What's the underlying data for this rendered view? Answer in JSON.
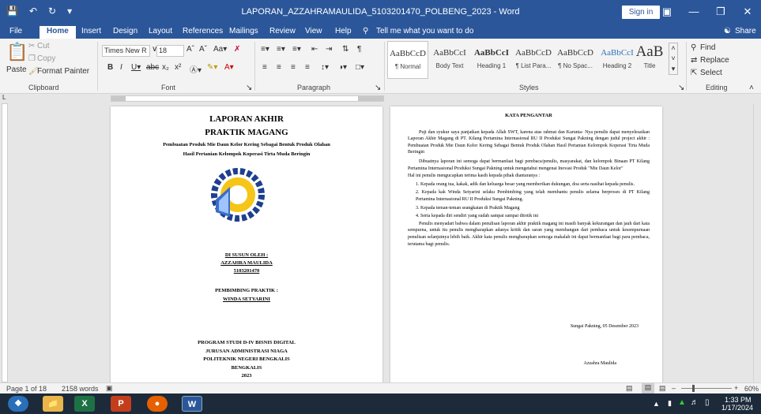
{
  "window": {
    "title": "LAPORAN_AZZAHRAMAULIDA_5103201470_POLBENG_2023 - Word",
    "sign_in": "Sign in"
  },
  "tabs": [
    "File",
    "Home",
    "Insert",
    "Design",
    "Layout",
    "References",
    "Mailings",
    "Review",
    "View",
    "Help"
  ],
  "tell_me": "Tell me what you want to do",
  "share": "Share",
  "clipboard": {
    "paste": "Paste",
    "cut": "Cut",
    "copy": "Copy",
    "format_painter": "Format Painter",
    "label": "Clipboard"
  },
  "font": {
    "name": "Times New R",
    "size": "18",
    "label": "Font"
  },
  "paragraph": {
    "label": "Paragraph"
  },
  "styles": {
    "label": "Styles",
    "items": [
      {
        "preview": "AaBbCcD",
        "name": "¶ Normal"
      },
      {
        "preview": "AaBbCcI",
        "name": "Body Text"
      },
      {
        "preview": "AaBbCcI",
        "name": "Heading 1"
      },
      {
        "preview": "AaBbCcD",
        "name": "¶ List Para..."
      },
      {
        "preview": "AaBbCcD",
        "name": "¶ No Spac..."
      },
      {
        "preview": "AaBbCcI",
        "name": "Heading 2"
      },
      {
        "preview": "AaB",
        "name": "Title"
      }
    ]
  },
  "editing": {
    "find": "Find",
    "replace": "Replace",
    "select": "Select",
    "label": "Editing"
  },
  "page1": {
    "title1": "LAPORAN AKHIR",
    "title2": "PRAKTIK MAGANG",
    "subtitle1": "Pembuatan Produk Mie Daun Kelor Kering Sebagai Bentuk Produk Olahan",
    "subtitle2": "Hasil Pertanian Kelompok Koperasi Tirta Muda Beringin",
    "disusun": "DI SUSUN OLEH :",
    "author": "AZZAHRA MAULIDA",
    "nim": "5103201470",
    "pembimbing": "PEMBIMBING PRAKTIK :",
    "mentor": "WINDA SETYARINI",
    "footer": [
      "PROGRAM STUDI D-IV BISNIS DIGITAL",
      "JURUSAN ADMINISTRASI NIAGA",
      "POLITEKNIK NEGERI BENGKALIS",
      "BENGKALIS",
      "2023"
    ]
  },
  "page2": {
    "heading": "KATA PENGANTAR",
    "para1": "Puji dan syukur saya panjatkan kepada Allah SWT, karena atas rahmat dan Karunia- Nya penulis dapat menyelesaikan Laporan Akhir Magang di PT. Kilang Pertamina Internasional RU II Produksi Sungai Pakning dengan judul project akhir : Pembuatan Produk Mie Daun Kelor Kering Sebagai Bentuk Produk Olahan Hasil Pertanian Kelompok Koperasi Tirta Muda Beringin",
    "para2": "Dibuatnya laporan ini semoga dapat bermanfaat bagi pembaca/penulis, masyarakat, dan kelompok Binaan PT Kilang Pertamina Internasional Produksi Sungai Pakning untuk mengetahui mengenai Inovasi Produk \"Mie Daun Kelor\"",
    "para3": "Hal ini penulis mengucapkan terima kasih kepada pihak diantaranya :",
    "list": [
      "1.  Kepada orang tua, kakak, adik dan keluarga besar yang memberikan dukungan, doa serta nasihat kepada penulis.",
      "2.  Kepada kak Winda Setyarini selaku Pembimbing yang telah membantu penulis selama berproses di PT Kilang Pertamina Internasional RU II Produksi Sungai Pakning.",
      "3.  Kepada teman-teman seangkatan di Praktik Magang",
      "4.  Serta kepada diri sendiri yang sudah sampai sampai ditotik ini"
    ],
    "para4": "Penulis menyadari bahwa dalam penulisan laporan akhir praktik magang ini masih banyak kekurangan dan jauh dari kata sempurna, untuk itu penulis mengharapkan adanya kritik dan saran yang membangun dari pembaca untuk kesempurnaan penulisan selanjutnya lebih baik. Akhir kata penulis mengharapkan semoga makalah ini dapat bermanfaat bagi para pembaca, terutama bagi penulis.",
    "date": "Sungai Pakning, 05 Desember 2023",
    "signature": "Azzahra Maulida"
  },
  "status": {
    "page": "Page 1 of 18",
    "words": "2158 words",
    "zoom": "60%"
  },
  "clock": {
    "time": "1:33 PM",
    "date": "1/17/2024"
  },
  "colors": {
    "word_blue": "#2b579a",
    "taskbar": "#1c2a3a"
  }
}
